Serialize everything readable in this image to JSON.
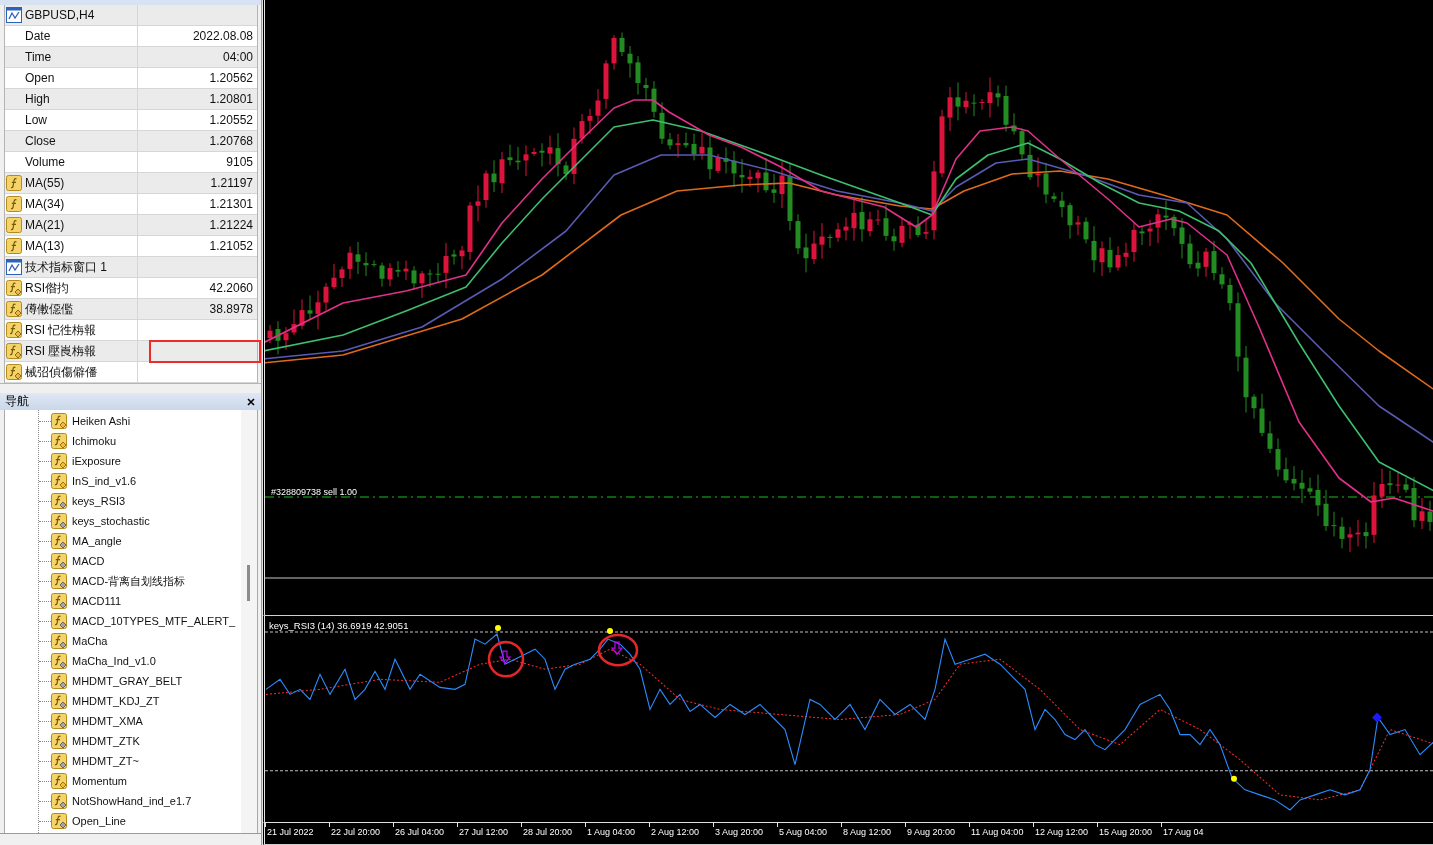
{
  "data_window": {
    "rows": [
      {
        "kind": "section",
        "label": "GBPUSD,H4",
        "highlighted": false
      },
      {
        "kind": "field",
        "label": "Date",
        "value": "2022.08.08",
        "highlighted": false
      },
      {
        "kind": "field",
        "label": "Time",
        "value": "04:00",
        "highlighted": false
      },
      {
        "kind": "field",
        "label": "Open",
        "value": "1.20562",
        "highlighted": false
      },
      {
        "kind": "field",
        "label": "High",
        "value": "1.20801",
        "highlighted": false
      },
      {
        "kind": "field",
        "label": "Low",
        "value": "1.20552",
        "highlighted": false
      },
      {
        "kind": "field",
        "label": "Close",
        "value": "1.20768",
        "highlighted": false
      },
      {
        "kind": "field",
        "label": "Volume",
        "value": "9105",
        "highlighted": false
      },
      {
        "kind": "indicator",
        "label": "MA(55)",
        "value": "1.21197",
        "highlighted": false
      },
      {
        "kind": "indicator",
        "label": "MA(34)",
        "value": "1.21301",
        "highlighted": false
      },
      {
        "kind": "indicator",
        "label": "MA(21)",
        "value": "1.21224",
        "highlighted": false
      },
      {
        "kind": "indicator",
        "label": "MA(13)",
        "value": "1.21052",
        "highlighted": false
      },
      {
        "kind": "section",
        "label": "技术指标窗口 1",
        "highlighted": false
      },
      {
        "kind": "custom",
        "label": "RSI偺抣",
        "value": "42.2060",
        "highlighted": false
      },
      {
        "kind": "custom",
        "label": "僔僌僫儖",
        "value": "38.8978",
        "highlighted": false
      },
      {
        "kind": "custom",
        "label": "RSI 忋徃栴報",
        "highlighted": false
      },
      {
        "kind": "custom",
        "label": "RSI 壓崀栴報",
        "highlighted": true
      },
      {
        "kind": "custom",
        "label": "械弨偵傷僻僠",
        "highlighted": false
      }
    ]
  },
  "navigator": {
    "title": "导航",
    "items": [
      {
        "label": "Heiken Ashi",
        "kind": "builtin"
      },
      {
        "label": "Ichimoku",
        "kind": "builtin"
      },
      {
        "label": "iExposure",
        "kind": "builtin"
      },
      {
        "label": "InS_ind_v1.6",
        "kind": "builtin"
      },
      {
        "label": "keys_RSI3",
        "kind": "custom"
      },
      {
        "label": "keys_stochastic",
        "kind": "custom"
      },
      {
        "label": "MA_angle",
        "kind": "custom"
      },
      {
        "label": "MACD",
        "kind": "custom"
      },
      {
        "label": "MACD-背离自划线指标",
        "kind": "custom"
      },
      {
        "label": "MACD111",
        "kind": "custom"
      },
      {
        "label": "MACD_10TYPES_MTF_ALERT_",
        "kind": "custom"
      },
      {
        "label": "MaCha",
        "kind": "custom"
      },
      {
        "label": "MaCha_Ind_v1.0",
        "kind": "custom"
      },
      {
        "label": "MHDMT_GRAY_BELT",
        "kind": "custom"
      },
      {
        "label": "MHDMT_KDJ_ZT",
        "kind": "custom"
      },
      {
        "label": "MHDMT_XMA",
        "kind": "custom"
      },
      {
        "label": "MHDMT_ZTK",
        "kind": "custom"
      },
      {
        "label": "MHDMT_ZT~",
        "kind": "custom"
      },
      {
        "label": "Momentum",
        "kind": "builtin"
      },
      {
        "label": "NotShowHand_ind_e1.7",
        "kind": "custom"
      },
      {
        "label": "Open_Line",
        "kind": "custom"
      }
    ]
  },
  "chart": {
    "order_label": "#328809738 sell 1.00",
    "indicator_title": "keys_RSI3 (14) 36.6919 42.9051",
    "time_axis": [
      "21 Jul 2022",
      "22 Jul 20:00",
      "26 Jul 04:00",
      "27 Jul 12:00",
      "28 Jul 20:00",
      "1 Aug 04:00",
      "2 Aug 12:00",
      "3 Aug 20:00",
      "5 Aug 04:00",
      "8 Aug 12:00",
      "9 Aug 20:00",
      "11 Aug 04:00",
      "12 Aug 12:00",
      "15 Aug 20:00",
      "17 Aug 04"
    ]
  }
}
